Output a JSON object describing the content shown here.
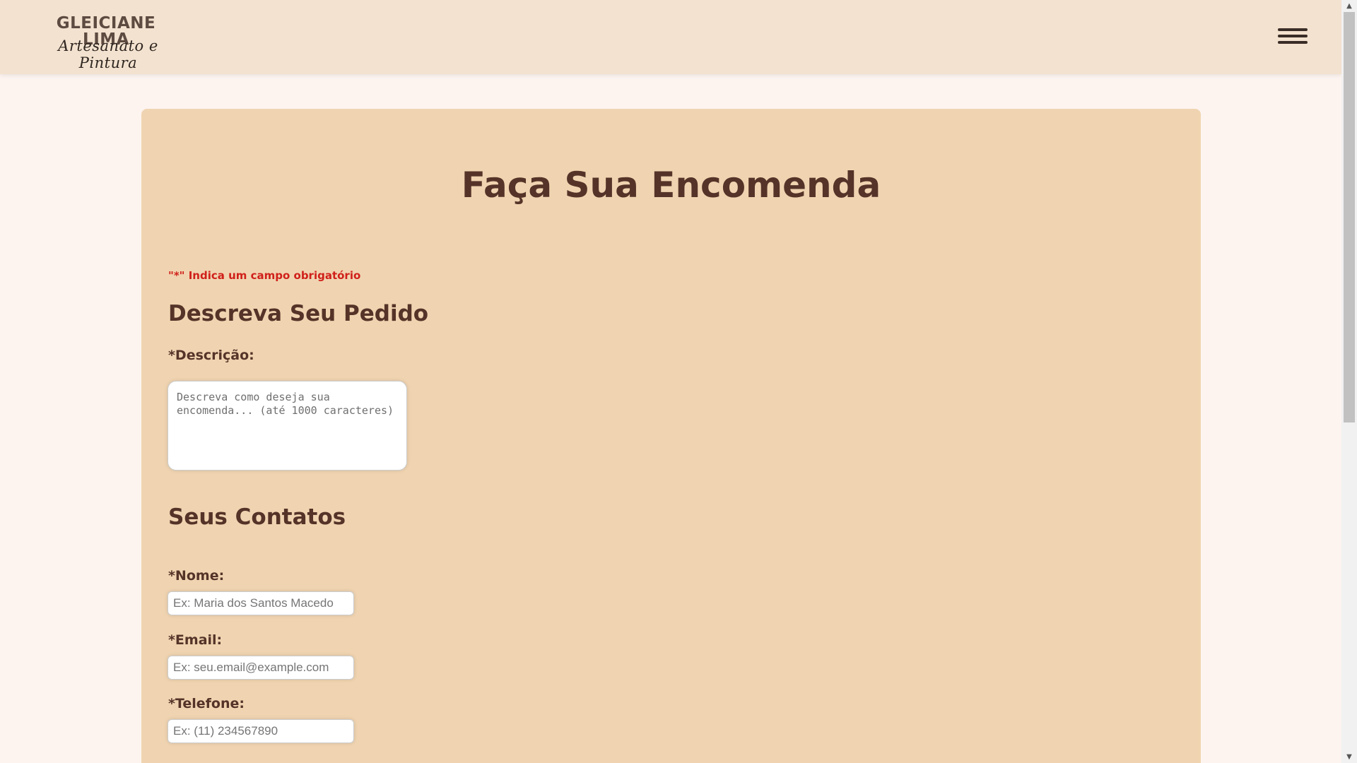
{
  "header": {
    "logo_main": "GLEICIANE LIMA",
    "logo_script": "Artesanato e Pintura",
    "menu_icon": "hamburger-menu-icon"
  },
  "form": {
    "title": "Faça Sua Encomenda",
    "required_note": "\"*\" Indica um campo obrigatório",
    "section_pedido": "Descreva Seu Pedido",
    "descricao_label": "*Descrição:",
    "descricao_placeholder": "Descreva como deseja sua encomenda... (até 1000 caracteres)",
    "section_contatos": "Seus Contatos",
    "nome_label": "*Nome:",
    "nome_placeholder": "Ex: Maria dos Santos Macedo",
    "email_label": "*Email:",
    "email_placeholder": "Ex: seu.email@example.com",
    "telefone_label": "*Telefone:",
    "telefone_placeholder": "Ex: (11) 234567890"
  },
  "colors": {
    "page_bg": "#fdf4f0",
    "header_bg": "#f3e2cf",
    "card_bg": "#f0d4b1",
    "heading": "#553328",
    "required": "#d0201a"
  }
}
